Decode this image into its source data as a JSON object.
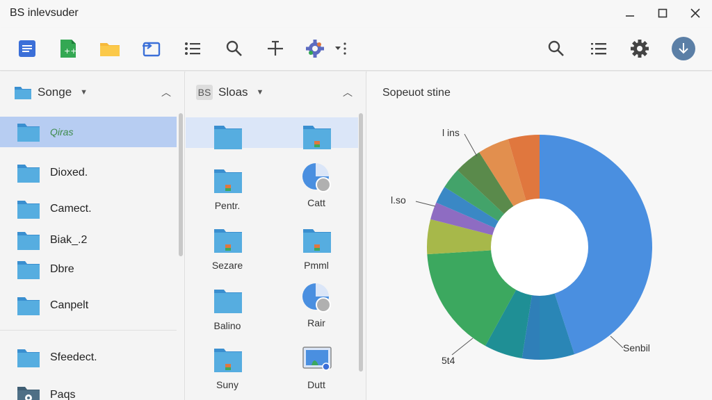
{
  "window": {
    "title": "BS inlevsuder"
  },
  "panels": {
    "left": {
      "header": "Songe",
      "items": [
        {
          "label": "Qiras"
        },
        {
          "label": "Dioxed."
        },
        {
          "label": "Camect."
        },
        {
          "label": "Biak_.2"
        },
        {
          "label": "Dbre"
        },
        {
          "label": "Canpelt"
        },
        {
          "label": "Sfeedect."
        },
        {
          "label": "Paqs"
        }
      ]
    },
    "middle": {
      "badge": "BS",
      "header": "Sloas",
      "items": [
        {
          "label": ""
        },
        {
          "label": ""
        },
        {
          "label": "Pentr."
        },
        {
          "label": "Catt"
        },
        {
          "label": "Sezare"
        },
        {
          "label": "Pmml"
        },
        {
          "label": "Balino"
        },
        {
          "label": "Rair"
        },
        {
          "label": "Suny"
        },
        {
          "label": "Dutt"
        }
      ]
    },
    "right": {
      "header": "Sopeuot stine"
    }
  },
  "chart_data": {
    "type": "pie",
    "title": "Sopeuot stine",
    "donut": true,
    "slices": [
      {
        "label": "Senbil",
        "value": 45,
        "color": "#4a8fe0"
      },
      {
        "label": "",
        "value": 5,
        "color": "#2a86b6"
      },
      {
        "label": "",
        "value": 2.5,
        "color": "#2f7fb8"
      },
      {
        "label": "",
        "value": 5.5,
        "color": "#1f8f95"
      },
      {
        "label": "",
        "value": 16,
        "color": "#3ca85f"
      },
      {
        "label": "",
        "value": 5,
        "color": "#a7b84a"
      },
      {
        "label": "",
        "value": 2.5,
        "color": "#8e6cc2"
      },
      {
        "label": "",
        "value": 2.5,
        "color": "#3a88c5"
      },
      {
        "label": "",
        "value": 3,
        "color": "#43a36a"
      },
      {
        "label": "",
        "value": 4,
        "color": "#5a8a4b"
      },
      {
        "label": "",
        "value": 4.5,
        "color": "#e28f4e"
      },
      {
        "label": "",
        "value": 4.5,
        "color": "#e0773e"
      }
    ],
    "annotations": [
      "l ins",
      "l.so",
      "5t4",
      "Senbil"
    ]
  },
  "colors": {
    "accent": "#4a8fe0",
    "selection": "#b7cdf2",
    "folder": "#56ade0"
  }
}
